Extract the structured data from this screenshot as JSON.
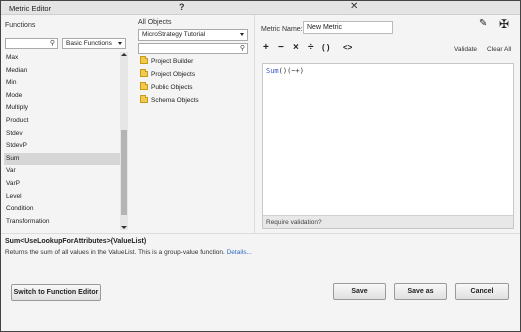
{
  "window": {
    "title": "Metric Editor",
    "help_glyph": "?",
    "close_glyph": "✕"
  },
  "functions": {
    "label": "Functions",
    "search_placeholder": "",
    "category": "Basic Functions",
    "items": [
      "Max",
      "Median",
      "Min",
      "Mode",
      "Multiply",
      "Product",
      "Stdev",
      "StdevP",
      "Sum",
      "Var",
      "VarP",
      "Level",
      "Condition",
      "Transformation"
    ],
    "selected": "Sum"
  },
  "objects": {
    "label": "All Objects",
    "source": "MicroStrategy Tutorial",
    "search_placeholder": "",
    "items": [
      "Project Builder",
      "Project Objects",
      "Public Objects",
      "Schema Objects"
    ]
  },
  "metric": {
    "name_label": "Metric Name:",
    "name_value": "New Metric",
    "edit_icon": "pencil-icon",
    "settings_icon": "tools-icon"
  },
  "toolbar": {
    "plus": "+",
    "minus": "−",
    "times": "×",
    "divide": "÷",
    "parens": "( )",
    "compare": "<>",
    "validate": "Validate",
    "clear_all": "Clear All"
  },
  "editor": {
    "fn": "Sum",
    "rest": "()(~+)",
    "footer": "Require validation?"
  },
  "details": {
    "syntax": "Sum<UseLookupForAttributes>(ValueList)",
    "description": "Returns the sum of all values in the ValueList. This is a group-value function.",
    "link": "Details..."
  },
  "buttons": {
    "switch": "Switch to Function Editor",
    "save": "Save",
    "save_as": "Save as",
    "cancel": "Cancel"
  }
}
